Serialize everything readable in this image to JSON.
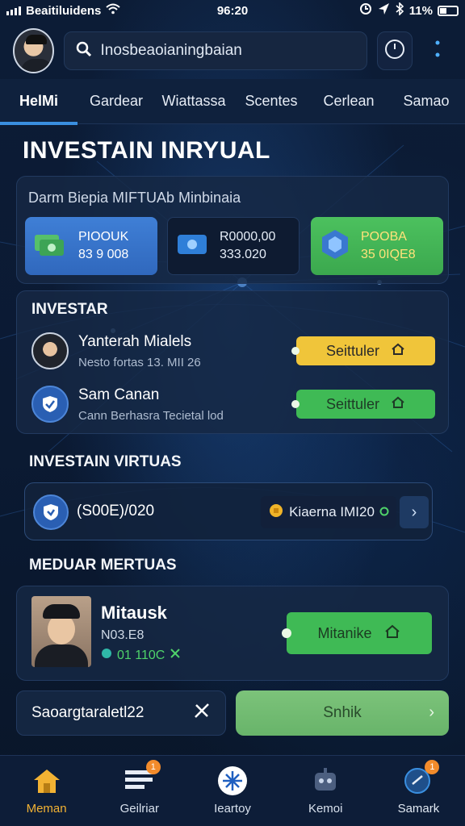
{
  "status_bar": {
    "carrier": "Beaitiluidens",
    "time": "96:20",
    "battery": "11%"
  },
  "header": {
    "search_placeholder": "Inosbeaoianingbaian"
  },
  "tabs": [
    {
      "label": "HelMi",
      "active": true
    },
    {
      "label": "Gardear"
    },
    {
      "label": "Wiattassa"
    },
    {
      "label": "Scentes"
    },
    {
      "label": "Cerlean"
    },
    {
      "label": "Samao"
    }
  ],
  "page_title": "INVESTAIN INRYUAL",
  "stats": {
    "title": "Darm Biepia MIFTUAb  Minbinaia",
    "cards": [
      {
        "line1": "PIOOUK",
        "line2": "83 9 008"
      },
      {
        "line1": "R0000,00",
        "line2": "333.020"
      },
      {
        "line1": "POOBA",
        "line2": "35 0IQE8"
      }
    ]
  },
  "investar": {
    "label": "INVESTAR",
    "rows": [
      {
        "name": "Yanterah Mialels",
        "sub": "Nesto fortas 13. MII 26",
        "action": "Seittuler"
      },
      {
        "name": "Sam Canan",
        "sub": "Cann Berhasra Tecietal lod",
        "action": "Seittuler"
      }
    ]
  },
  "virtuas": {
    "label": "INVESTAIN VIRTUAS",
    "amount": "(S00E)/020",
    "chip": "Kiaerna IMI20"
  },
  "mediar": {
    "label": "MEDUAR MERTUAS",
    "name": "Mitausk",
    "sub": "N03.E8",
    "value": "01 110C",
    "action": "Mitanike"
  },
  "actions": {
    "left": "Saoargtaraletl22",
    "right": "Snhik"
  },
  "bottom_nav": [
    {
      "label": "Meman",
      "icon": "home-icon",
      "active": true
    },
    {
      "label": "Geilriar",
      "icon": "list-icon",
      "badge": "1"
    },
    {
      "label": "Ieartoy",
      "icon": "compass-icon"
    },
    {
      "label": "Kemoi",
      "icon": "robot-icon"
    },
    {
      "label": "Samark",
      "icon": "chat-icon",
      "badge": "1"
    }
  ],
  "colors": {
    "accent_blue": "#3a8fe0",
    "accent_green": "#3fba55",
    "accent_yellow": "#f0c53a",
    "active_nav": "#f2b233"
  }
}
